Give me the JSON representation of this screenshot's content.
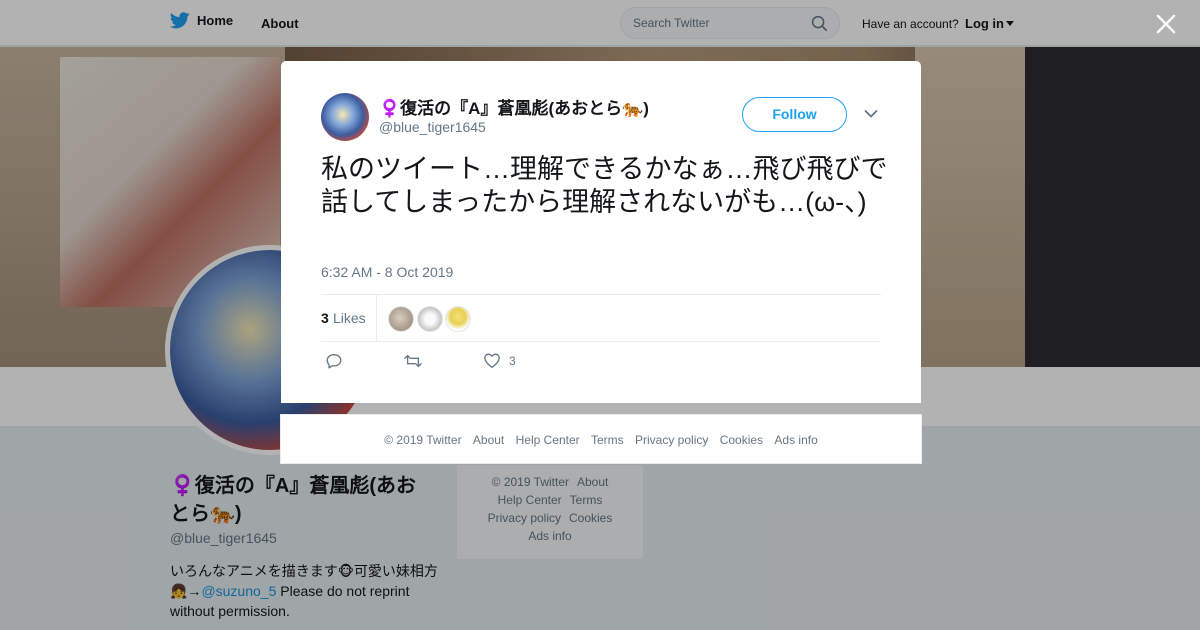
{
  "nav": {
    "home_label": "Home",
    "about_label": "About",
    "search_placeholder": "Search Twitter",
    "account_question": "Have an account?",
    "login_label": "Log in"
  },
  "profile": {
    "name": "♀️復活の『A』蒼凰彪(あおとら🐅)",
    "handle": "@blue_tiger1645",
    "bio_text": "いろんなアニメを描きます🐵可愛い妹相方👧→",
    "bio_link": "@suzuno_5",
    "bio_tail": "  Please do not reprint without permission."
  },
  "side_footer": {
    "items": [
      "© 2019 Twitter",
      "About",
      "Help Center",
      "Terms",
      "Privacy policy",
      "Cookies",
      "Ads info"
    ]
  },
  "tweet": {
    "author_name": "♀️復活の『A』蒼凰彪(あおとら🐅)",
    "author_handle": "@blue_tiger1645",
    "follow_label": "Follow",
    "text": "私のツイート…理解できるかなぁ…飛び飛びで話してしまったから理解されないがも…(ω-、)",
    "timestamp": "6:32 AM - 8 Oct 2019",
    "likes_count": "3",
    "likes_label": "Likes",
    "like_action_count": "3"
  },
  "modal_footer": {
    "items": [
      "© 2019 Twitter",
      "About",
      "Help Center",
      "Terms",
      "Privacy policy",
      "Cookies",
      "Ads info"
    ]
  },
  "colors": {
    "accent": "#1da1f2",
    "link": "#1b95e0",
    "muted_text": "#657786",
    "overlay": "rgba(0,0,0,0.3)"
  },
  "icons": {
    "logo": "twitter-bird-icon",
    "search": "search-icon",
    "close": "close-icon",
    "menu": "chevron-down-icon",
    "reply": "reply-icon",
    "retweet": "retweet-icon",
    "like": "heart-icon"
  }
}
